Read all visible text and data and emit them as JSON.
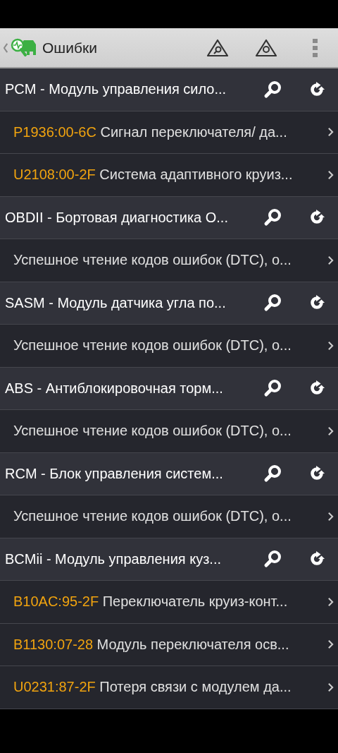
{
  "header": {
    "title": "Ошибки"
  },
  "modules": [
    {
      "name": "PCM - Модуль управления сило...",
      "items": [
        {
          "kind": "dtc",
          "code": "P1936:00-6C",
          "text": "Сигнал переключателя/ да..."
        },
        {
          "kind": "dtc",
          "code": "U2108:00-2F",
          "text": "Система адаптивного круиз..."
        }
      ]
    },
    {
      "name": "OBDII - Бортовая диагностика О...",
      "items": [
        {
          "kind": "message",
          "text": "Успешное чтение кодов ошибок (DTC), о..."
        }
      ]
    },
    {
      "name": "SASM - Модуль датчика угла по...",
      "items": [
        {
          "kind": "message",
          "text": "Успешное чтение кодов ошибок (DTC), о..."
        }
      ]
    },
    {
      "name": "ABS - Антиблокировочная торм...",
      "items": [
        {
          "kind": "message",
          "text": "Успешное чтение кодов ошибок (DTC), о..."
        }
      ]
    },
    {
      "name": "RCM - Блок управления систем...",
      "items": [
        {
          "kind": "message",
          "text": "Успешное чтение кодов ошибок (DTC), о..."
        }
      ]
    },
    {
      "name": "BCMii - Модуль управления куз...",
      "items": [
        {
          "kind": "dtc",
          "code": "B10AC:95-2F",
          "text": "Переключатель круиз-конт..."
        },
        {
          "kind": "dtc",
          "code": "B1130:07-28",
          "text": "Модуль переключателя осв..."
        },
        {
          "kind": "dtc",
          "code": "U0231:87-2F",
          "text": "Потеря связи с модулем да..."
        }
      ]
    }
  ]
}
